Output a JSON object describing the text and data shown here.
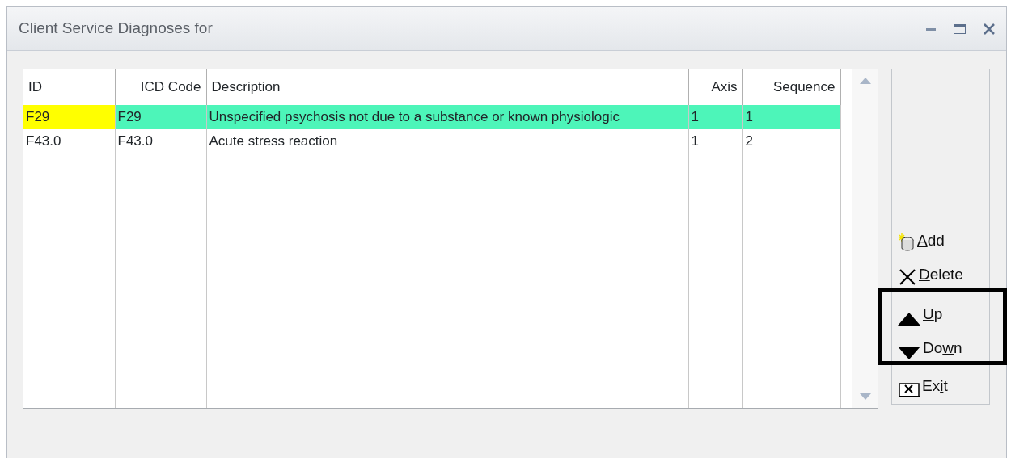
{
  "window": {
    "title": "Client Service Diagnoses for"
  },
  "table": {
    "columns": [
      "ID",
      "ICD Code",
      "Description",
      "Axis",
      "Sequence"
    ],
    "rows": [
      {
        "selected": true,
        "cells": [
          "F29",
          "F29",
          "Unspecified psychosis not due to a substance or known physiologic",
          "1",
          "1"
        ]
      },
      {
        "selected": false,
        "cells": [
          "F43.0",
          "F43.0",
          "Acute stress reaction",
          "1",
          "2"
        ]
      }
    ]
  },
  "buttons": [
    {
      "kind": "add",
      "highlighted": false,
      "label_parts": {
        "key": "A",
        "after": "dd"
      }
    },
    {
      "kind": "delete",
      "highlighted": false,
      "label_parts": {
        "key": "D",
        "after": "elete"
      }
    },
    {
      "kind": "up",
      "highlighted": true,
      "label_parts": {
        "key": "U",
        "after": "p"
      }
    },
    {
      "kind": "down",
      "highlighted": true,
      "label_parts": {
        "before": "Do",
        "key": "w",
        "after": "n"
      }
    },
    {
      "kind": "exit",
      "highlighted": false,
      "label_parts": {
        "before": "Ex",
        "key": "i",
        "after": "t"
      }
    }
  ]
}
